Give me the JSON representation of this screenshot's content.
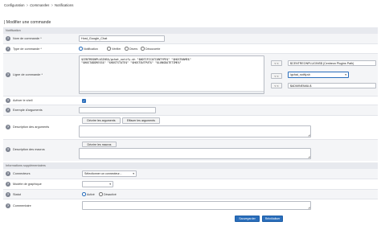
{
  "breadcrumb": {
    "items": [
      "Configuration",
      "Commandes",
      "Notifications"
    ],
    "separator": ">"
  },
  "page_title": "| Modifier une commande",
  "notification_section": {
    "title": "Notification",
    "command_name": {
      "label": "Nom de commande",
      "required": "*",
      "value": "Host_Google_Chat"
    },
    "command_type": {
      "label": "Type de commande",
      "required": "*",
      "options": [
        "Notification",
        "Vérifier",
        "Divers",
        "Découverte"
      ],
      "selected": "Notification"
    },
    "command_line": {
      "label": "Ligne de commande",
      "required": "*",
      "value": "$CENTREONPLUGINS$/gchat_notify.sh \"$NOTIFICATIONTYPE$\" \"$HOSTNAME$\"\n\"$HOSTADDRESS$\" \"$HOSTSTATE$\" \"$HOSTOUTPUT$\" \"$LONGDATETIME$\"",
      "insert_button": "< <",
      "macros": [
        {
          "value": "$CENTREONPLUGINS$ (Centreon Plugins Path)"
        },
        {
          "value": "/gchat_notify.sh"
        },
        {
          "value": "$ADMINEMAIL$"
        }
      ]
    },
    "enable_shell": {
      "label": "Activer le shell",
      "checked": true,
      "check_glyph": "✓"
    },
    "argument_example": {
      "label": "Exemple d'arguments",
      "value": ""
    },
    "argument_description": {
      "label": "Description des arguments",
      "describe_button": "Décrire les arguments",
      "clear_button": "Effacer les arguments"
    },
    "macro_description": {
      "label": "Description des macros",
      "describe_button": "Décrire les macros"
    }
  },
  "extra_section": {
    "title": "Informations supplémentaires",
    "connectors": {
      "label": "Connecteurs",
      "value": "Sélectionner un connecteur..."
    },
    "graph_template": {
      "label": "Modèle de graphique",
      "value": ""
    },
    "status": {
      "label": "Statut",
      "options": [
        "Activé",
        "Désactivé"
      ],
      "selected": "Activé"
    },
    "comment": {
      "label": "Commentaire",
      "value": ""
    }
  },
  "actions": {
    "save": "Sauvegarder",
    "reset": "Réinitialiser"
  },
  "help_glyph": "?",
  "caret_glyph": "▾",
  "colors": {
    "primary": "#2a6ebb",
    "section_bg": "#e7e9ee",
    "row_alt_bg": "#f4f5f7",
    "help_icon": "#7d8390"
  }
}
